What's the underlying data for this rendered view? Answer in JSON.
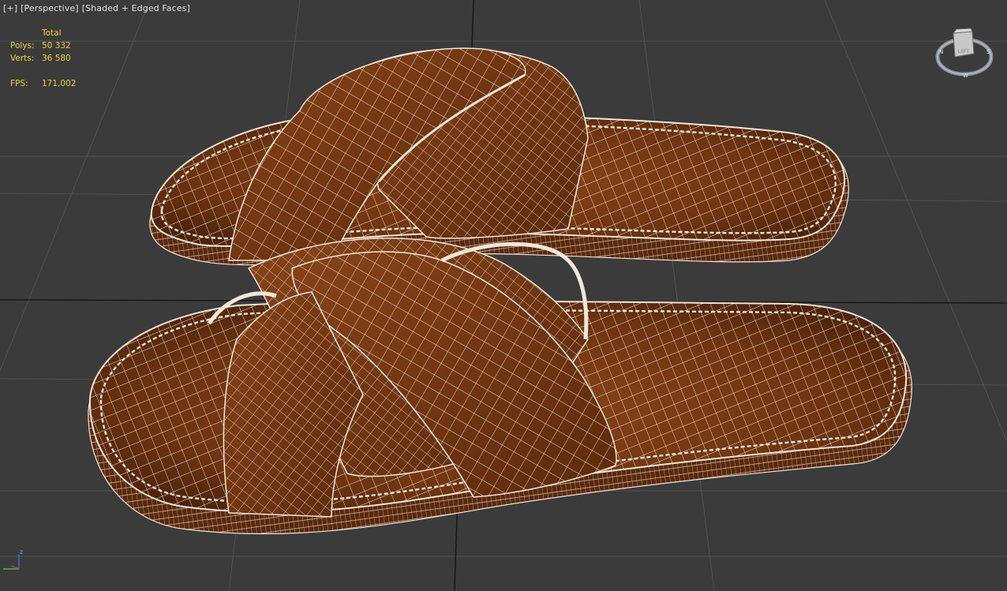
{
  "viewport": {
    "labels": {
      "plus": "[+]",
      "view": "[Perspective]",
      "shading": "[Shaded + Edged Faces]"
    },
    "stats": {
      "header": "Total",
      "polys_label": "Polys:",
      "polys_value": "50 332",
      "verts_label": "Verts:",
      "verts_value": "36 580",
      "fps_label": "FPS:",
      "fps_value": "171,002"
    },
    "viewcube": {
      "face_label": "LEFT"
    },
    "axis": {
      "z_label": "z"
    }
  },
  "colors": {
    "background": "#3b3b3b",
    "grid": "#525252",
    "grid_main": "#161616",
    "leather": "#7a3c12",
    "wire": "#f1e6da",
    "stats_text": "#e8d23a"
  },
  "icons": [
    "viewcube-icon",
    "axis-tripod-icon"
  ]
}
